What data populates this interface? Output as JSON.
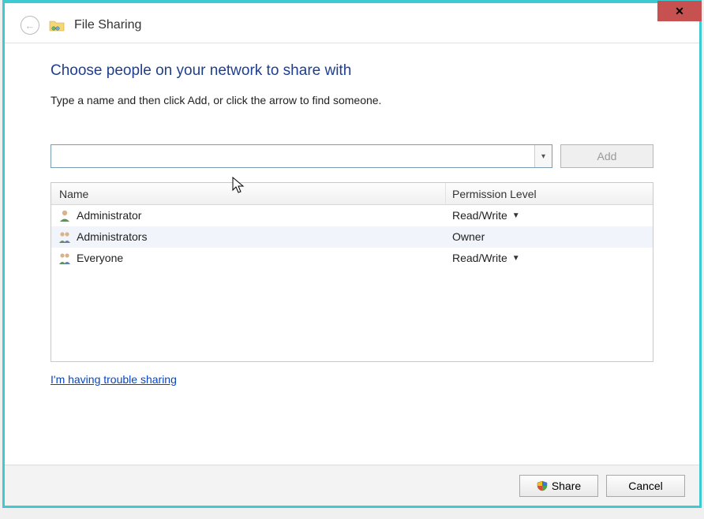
{
  "window": {
    "title": "File Sharing",
    "close_glyph": "✕"
  },
  "content": {
    "heading": "Choose people on your network to share with",
    "instruction": "Type a name and then click Add, or click the arrow to find someone.",
    "name_input_value": "",
    "name_input_placeholder": "",
    "add_label": "Add",
    "trouble_link": "I'm having trouble sharing"
  },
  "table": {
    "columns": {
      "name": "Name",
      "permission": "Permission Level"
    },
    "rows": [
      {
        "icon": "user",
        "name": "Administrator",
        "permission": "Read/Write",
        "dropdown": true,
        "selected": false
      },
      {
        "icon": "group",
        "name": "Administrators",
        "permission": "Owner",
        "dropdown": false,
        "selected": true
      },
      {
        "icon": "group",
        "name": "Everyone",
        "permission": "Read/Write",
        "dropdown": true,
        "selected": false
      }
    ]
  },
  "footer": {
    "share_label": "Share",
    "cancel_label": "Cancel"
  }
}
